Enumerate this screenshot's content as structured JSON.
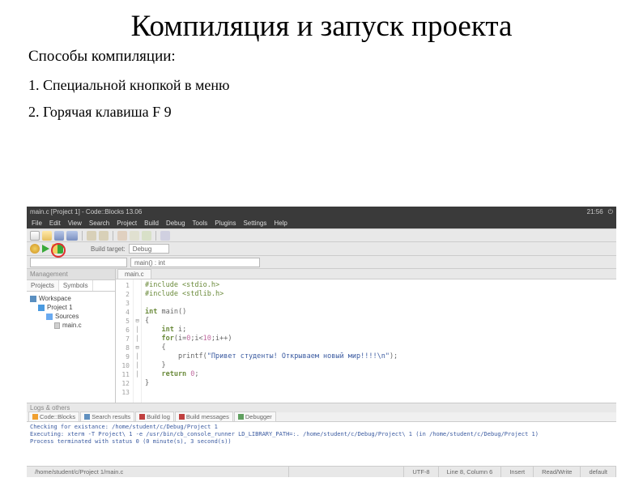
{
  "slide": {
    "title": "Компиляция и запуск проекта",
    "subtitle": "Способы компиляции:",
    "bullet1": "1. Специальной кнопкой в меню",
    "bullet2": "2. Горячая клавиша F 9"
  },
  "titlebar": {
    "text": "main.c [Project 1] - Code::Blocks 13.06",
    "clock": "21:56"
  },
  "menu": {
    "file": "File",
    "edit": "Edit",
    "view": "View",
    "search": "Search",
    "project": "Project",
    "build": "Build",
    "debug": "Debug",
    "tools": "Tools",
    "plugins": "Plugins",
    "settings": "Settings",
    "help": "Help"
  },
  "toolbar2": {
    "label": "Build target:",
    "target": "Debug"
  },
  "scope": {
    "fn": "main() : int"
  },
  "panel": {
    "title": "Management",
    "tab_projects": "Projects",
    "tab_symbols": "Symbols"
  },
  "tree": {
    "workspace": "Workspace",
    "project": "Project 1",
    "sources": "Sources",
    "file": "main.c"
  },
  "editor": {
    "tab": "main.c",
    "lines": [
      "1",
      "2",
      "3",
      "4",
      "5",
      "6",
      "7",
      "8",
      "9",
      "10",
      "11",
      "12",
      "13"
    ],
    "code": {
      "l1": "#include <stdio.h>",
      "l2": "#include <stdlib.h>",
      "l4a": "int",
      "l4b": " main()",
      "l5": "{",
      "l6a": "    int",
      "l6b": " i;",
      "l7a": "    for",
      "l7b": "(i=",
      "l7c": "0",
      "l7d": ";i<",
      "l7e": "10",
      "l7f": ";i++)",
      "l8": "    {",
      "l9a": "        printf(",
      "l9b": "\"Привет студенты! Открываем новый мир!!!!\\n\"",
      "l9c": ");",
      "l10": "    }",
      "l11a": "    return ",
      "l11b": "0",
      "l11c": ";",
      "l12": "}"
    }
  },
  "logs": {
    "title": "Logs & others",
    "tab_cb": "Code::Blocks",
    "tab_search": "Search results",
    "tab_buildlog": "Build log",
    "tab_buildmsg": "Build messages",
    "tab_debugger": "Debugger",
    "line1": "Checking for existance: /home/student/c/Debug/Project 1",
    "line2": "Executing: xterm -T Project\\ 1 -e /usr/bin/cb_console_runner LD_LIBRARY_PATH=:. /home/student/c/Debug/Project\\ 1  (in /home/student/c/Debug/Project 1)",
    "line3": "Process terminated with status 0 (0 minute(s), 3 second(s))"
  },
  "status": {
    "path": "/home/student/c/Project 1/main.c",
    "encoding": "UTF-8",
    "pos": "Line 8, Column 6",
    "insert": "Insert",
    "rw": "Read/Write",
    "profile": "default"
  }
}
